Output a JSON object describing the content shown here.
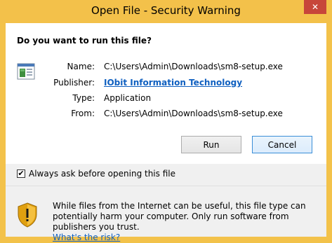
{
  "window": {
    "title": "Open File - Security Warning",
    "close_glyph": "✕"
  },
  "dialog": {
    "question": "Do you want to run this file?",
    "file_icon": "application-window-icon",
    "fields": {
      "name_label": "Name:",
      "name_value": "C:\\Users\\Admin\\Downloads\\sm8-setup.exe",
      "publisher_label": "Publisher:",
      "publisher_value": "IObit Information Technology",
      "type_label": "Type:",
      "type_value": "Application",
      "from_label": "From:",
      "from_value": "C:\\Users\\Admin\\Downloads\\sm8-setup.exe"
    },
    "buttons": {
      "run": "Run",
      "cancel": "Cancel"
    },
    "checkbox": {
      "label": "Always ask before opening this file",
      "checked": true,
      "glyph": "✔"
    },
    "warning": {
      "icon": "shield-warning-icon",
      "text": "While files from the Internet can be useful, this file type can potentially harm your computer. Only run software from publishers you trust.",
      "link": "What's the risk?"
    }
  },
  "colors": {
    "titlebar": "#f3c14a",
    "link": "#1060c0",
    "close_button": "#c7463a"
  }
}
